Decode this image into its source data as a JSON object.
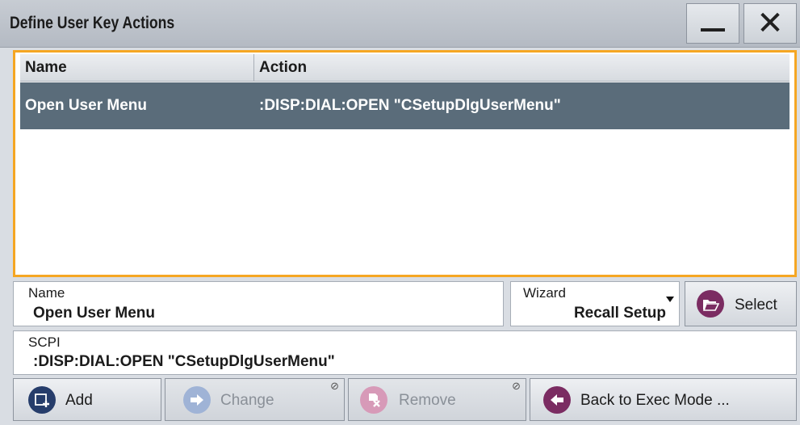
{
  "dialog": {
    "title": "Define User Key Actions"
  },
  "window_buttons": {
    "minimize_icon": "minimize-icon",
    "close_icon": "close-icon"
  },
  "table": {
    "headers": {
      "name": "Name",
      "action": "Action"
    },
    "rows": [
      {
        "name": "Open User Menu",
        "action": ":DISP:DIAL:OPEN \"CSetupDlgUserMenu\"",
        "selected": true
      }
    ]
  },
  "name_field": {
    "label": "Name",
    "value": "Open User Menu"
  },
  "wizard": {
    "label": "Wizard",
    "value": "Recall Setup"
  },
  "select_button": {
    "label": "Select"
  },
  "scpi_field": {
    "label": "SCPI",
    "value": ":DISP:DIAL:OPEN \"CSetupDlgUserMenu\""
  },
  "buttons": {
    "add": {
      "label": "Add"
    },
    "change": {
      "label": "Change",
      "disabled": true
    },
    "remove": {
      "label": "Remove",
      "disabled": true
    },
    "back": {
      "label": "Back to Exec Mode ..."
    }
  },
  "colors": {
    "accent_border": "#f5a623",
    "selected_row": "#5a6c7a",
    "button_icon_purple": "#7b2c62",
    "button_icon_navy": "#263d6b",
    "disabled_icon_blue": "#9fb3d6",
    "disabled_icon_pink": "#d79ab8"
  }
}
